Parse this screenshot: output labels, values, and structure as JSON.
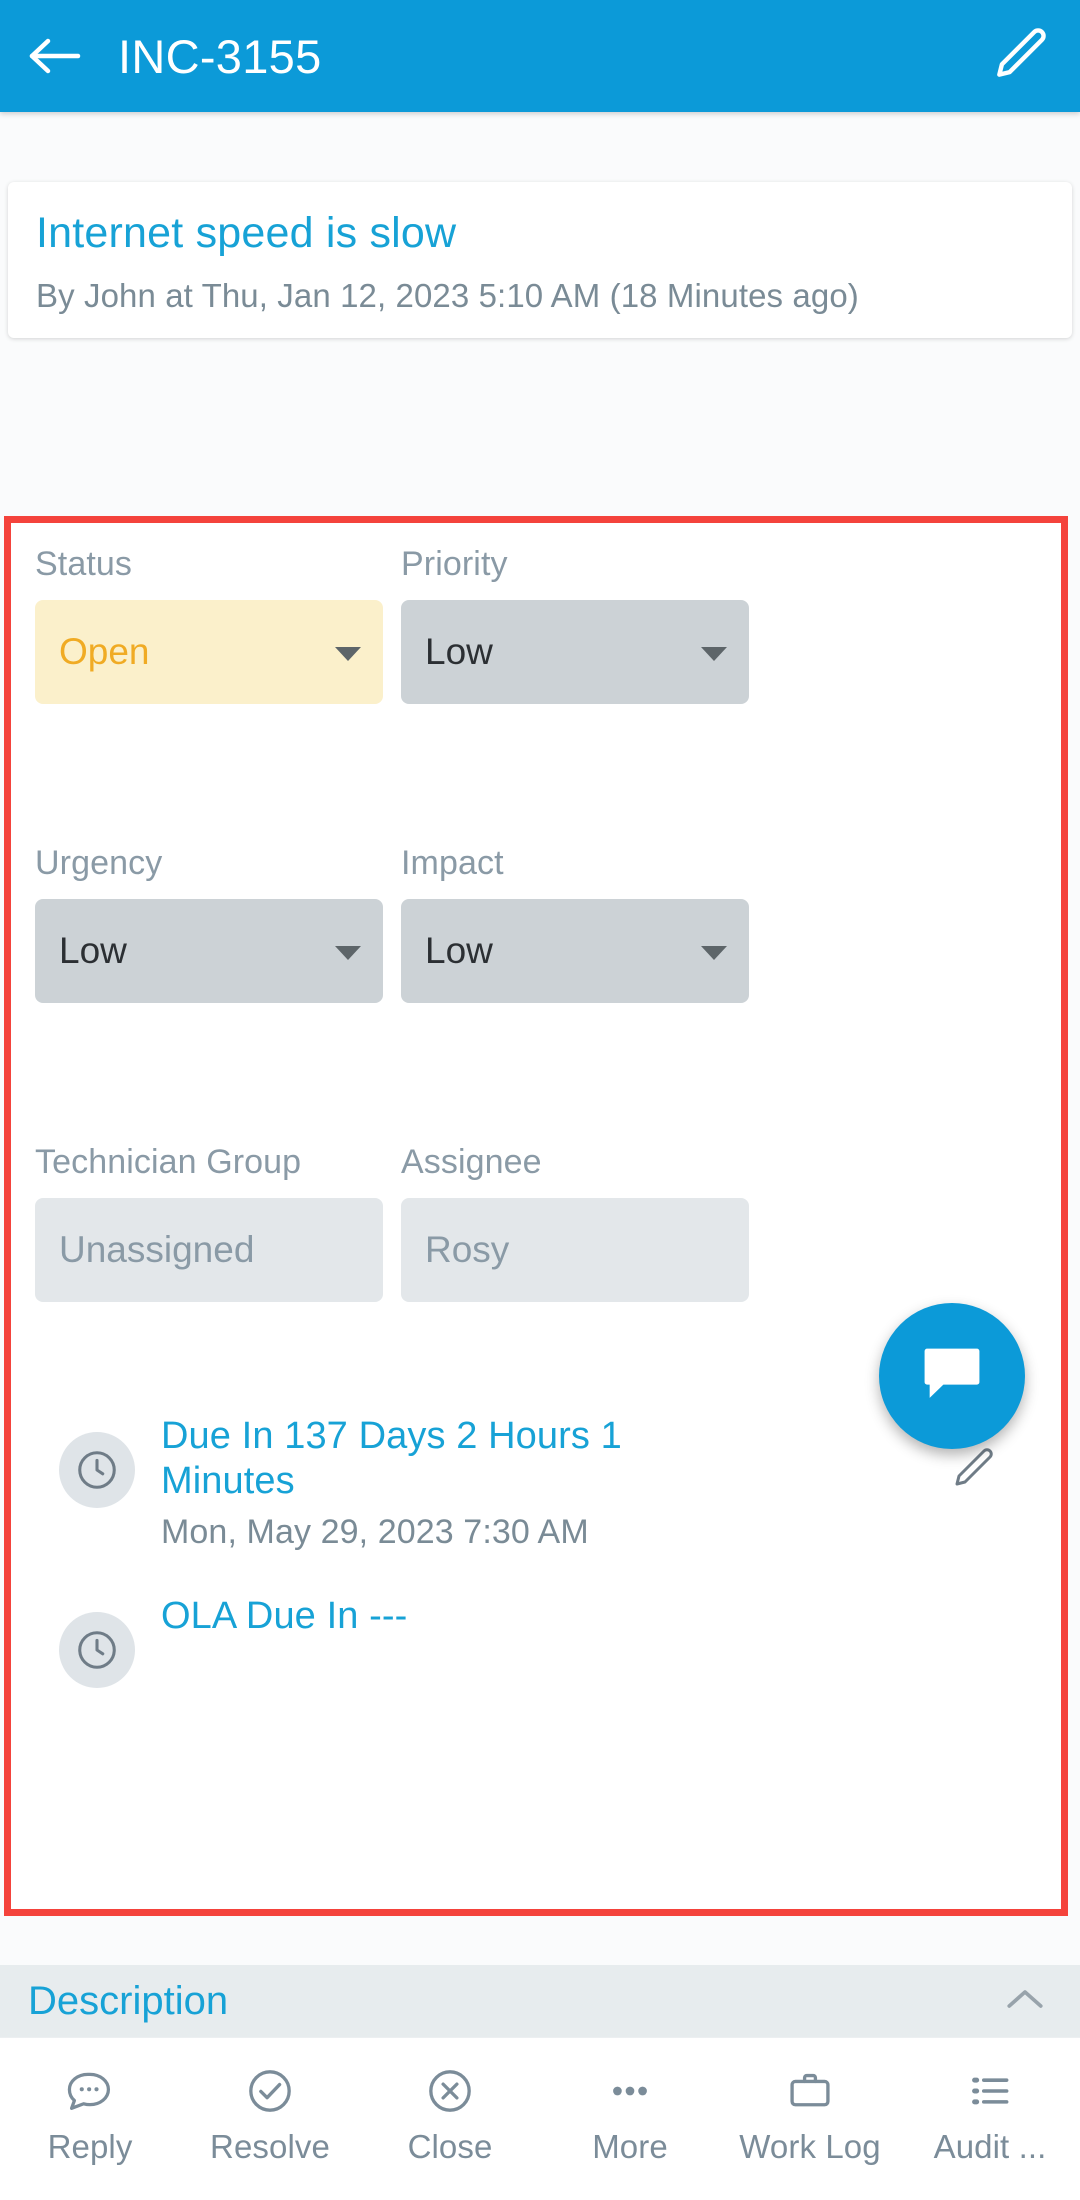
{
  "header": {
    "title": "INC-3155",
    "back_icon": "arrow-left-icon",
    "edit_icon": "pencil-icon"
  },
  "ticket": {
    "title": "Internet speed is slow",
    "meta": "By John at Thu, Jan 12, 2023 5:10 AM (18 Minutes ago)"
  },
  "fields": {
    "status": {
      "label": "Status",
      "value": "Open"
    },
    "priority": {
      "label": "Priority",
      "value": "Low"
    },
    "urgency": {
      "label": "Urgency",
      "value": "Low"
    },
    "impact": {
      "label": "Impact",
      "value": "Low"
    },
    "technician_group": {
      "label": "Technician Group",
      "value": "Unassigned"
    },
    "assignee": {
      "label": "Assignee",
      "value": "Rosy"
    }
  },
  "sla": {
    "due_in": {
      "icon": "clock-icon",
      "main": "Due In 137 Days 2 Hours 1 Minutes",
      "sub": "Mon, May 29, 2023 7:30 AM",
      "edit_icon": "pencil-icon"
    },
    "ola_due_in": {
      "icon": "clock-icon",
      "main": "OLA Due In ---"
    }
  },
  "fab": {
    "icon": "chat-bubble-icon"
  },
  "description": {
    "label": "Description",
    "chevron": "chevron-up-icon"
  },
  "bottom_bar": [
    {
      "label": "Reply",
      "icon": "chat-dots-icon"
    },
    {
      "label": "Resolve",
      "icon": "check-circle-icon"
    },
    {
      "label": "Close",
      "icon": "x-circle-icon"
    },
    {
      "label": "More",
      "icon": "ellipsis-icon"
    },
    {
      "label": "Work Log",
      "icon": "briefcase-icon"
    },
    {
      "label": "Audit ...",
      "icon": "list-icon"
    }
  ],
  "colors": {
    "accent": "#0c9ad8",
    "link": "#17a2d6",
    "status_bg": "#fbf0cb",
    "status_text": "#f0ab24",
    "select_bg": "#ccd2d6",
    "readonly_bg": "#e3e7ea",
    "muted_text": "#7a8b96",
    "highlight_border": "#f4433c"
  }
}
